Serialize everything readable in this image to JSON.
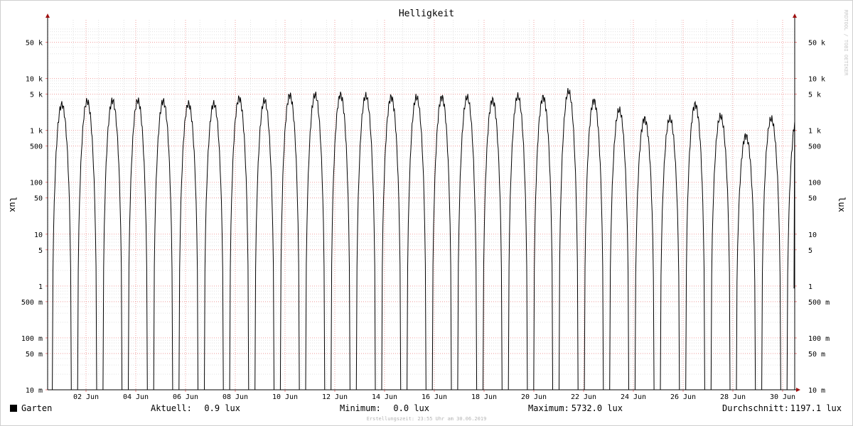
{
  "chart_data": {
    "type": "line",
    "title": "Helligkeit",
    "ylabel_left": "lux",
    "ylabel_right": "lux",
    "y_scale": "log",
    "ylim": [
      0.01,
      100000
    ],
    "y_ticks": [
      {
        "value": 50000,
        "label": "50 k"
      },
      {
        "value": 10000,
        "label": "10 k"
      },
      {
        "value": 5000,
        "label": "5 k"
      },
      {
        "value": 1000,
        "label": "1 k"
      },
      {
        "value": 500,
        "label": "500"
      },
      {
        "value": 100,
        "label": "100"
      },
      {
        "value": 50,
        "label": "50"
      },
      {
        "value": 10,
        "label": "10"
      },
      {
        "value": 5,
        "label": "5"
      },
      {
        "value": 1,
        "label": "1"
      },
      {
        "value": 0.5,
        "label": "500 m"
      },
      {
        "value": 0.1,
        "label": "100 m"
      },
      {
        "value": 0.05,
        "label": "50 m"
      },
      {
        "value": 0.01,
        "label": "10 m"
      }
    ],
    "x_ticks": [
      "02 Jun",
      "04 Jun",
      "06 Jun",
      "08 Jun",
      "10 Jun",
      "12 Jun",
      "14 Jun",
      "16 Jun",
      "18 Jun",
      "20 Jun",
      "22 Jun",
      "24 Jun",
      "26 Jun",
      "28 Jun",
      "30 Jun"
    ],
    "grid": true,
    "series": [
      {
        "name": "Garten",
        "color": "#000000",
        "daily_peaks_lux": [
          3200,
          3700,
          3800,
          3800,
          3700,
          3300,
          3300,
          4200,
          3800,
          4800,
          4900,
          4900,
          4700,
          4400,
          4400,
          4400,
          4400,
          3900,
          4600,
          4400,
          5700,
          3800,
          2500,
          1700,
          1700,
          3200,
          1900,
          800,
          1700,
          1700,
          2700
        ]
      }
    ]
  },
  "credit": "RRDTOOL / TOBI OETIKER",
  "legend": {
    "series_name": "Garten",
    "swatch_color": "#000000",
    "current_label": "Aktuell:",
    "current_value": "0.9 lux",
    "min_label": "Minimum:",
    "min_value": "0.0 lux",
    "max_label": "Maximum:",
    "max_value": "5732.0 lux",
    "avg_label": "Durchschnitt:",
    "avg_value": "1197.1 lux"
  },
  "footer": "Erstellungszeit: 23:55 Uhr am 30.06.2019"
}
